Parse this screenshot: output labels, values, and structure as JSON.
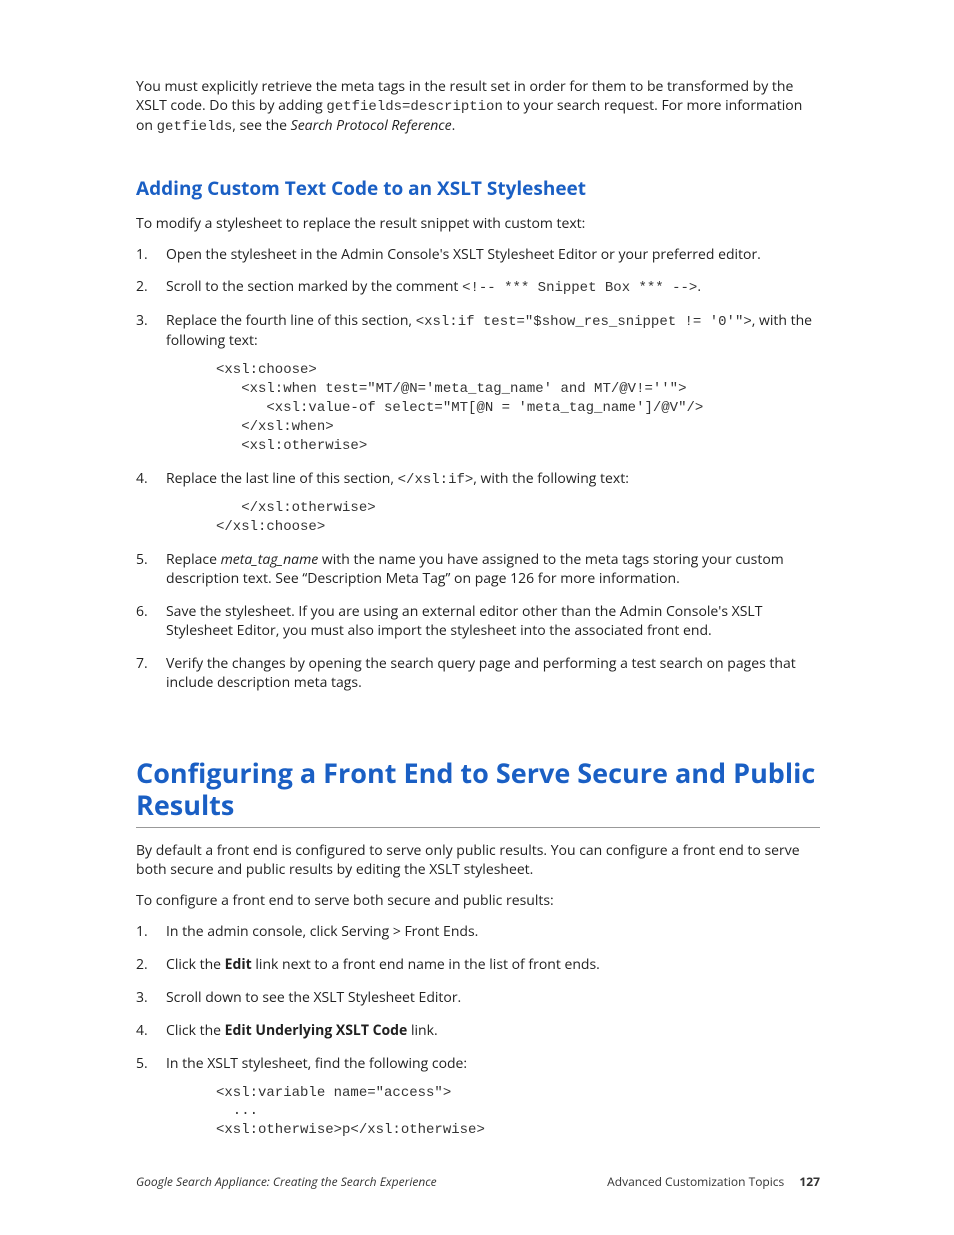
{
  "intro": {
    "p1a": "You must explicitly retrieve the meta tags in the result set in order for them to be transformed by the XSLT code. Do this by adding ",
    "code1": "getfields=description",
    "p1b": " to your search request. For more information on ",
    "code2": "getfields",
    "p1c": ", see the ",
    "ital": "Search Protocol Reference",
    "p1d": "."
  },
  "h2": "Adding Custom Text Code to an XSLT Stylesheet",
  "lead1": "To modify a stylesheet to replace the result snippet with custom text:",
  "steps1": {
    "s1": "Open the stylesheet in the Admin Console's XSLT Stylesheet Editor or your preferred editor.",
    "s2a": "Scroll to the section marked by the comment ",
    "s2code": "<!-- *** Snippet Box *** -->",
    "s2b": ".",
    "s3a": "Replace the fourth line of this section, ",
    "s3code": "<xsl:if test=\"$show_res_snippet != '0'\">",
    "s3b": ", with the following text:",
    "code3": "<xsl:choose>\n   <xsl:when test=\"MT/@N='meta_tag_name' and MT/@V!=''\">\n      <xsl:value-of select=\"MT[@N = 'meta_tag_name']/@V\"/>\n   </xsl:when>\n   <xsl:otherwise>",
    "s4a": "Replace the last line of this section, ",
    "s4code": "</xsl:if>",
    "s4b": ", with the following text:",
    "code4": "   </xsl:otherwise>\n</xsl:choose>",
    "s5a": "Replace ",
    "s5ital": "meta_tag_name",
    "s5b": " with the name you have assigned to the meta tags storing your custom description text. See “Description Meta Tag” on page 126 for more information.",
    "s6": "Save the stylesheet. If you are using an external editor other than the Admin Console's XSLT Stylesheet Editor, you must also import the stylesheet into the associated front end.",
    "s7": "Verify the changes by opening the search query page and performing a test search on pages that include description meta tags."
  },
  "h1": "Configuring a Front End to Serve Secure and Public Results",
  "lead2": "By default a front end is configured to serve only public results. You can configure a front end to serve both secure and public results by editing the XSLT stylesheet.",
  "lead3": "To configure a front end to serve both secure and public results:",
  "steps2": {
    "s1": "In the admin console, click Serving > Front Ends.",
    "s2a": "Click the ",
    "s2bold": "Edit",
    "s2b": " link next to a front end name in the list of front ends.",
    "s3": "Scroll down to see the XSLT Stylesheet Editor.",
    "s4a": "Click the ",
    "s4bold": "Edit Underlying XSLT Code",
    "s4b": " link.",
    "s5": "In the XSLT stylesheet, find the following code:",
    "code5": "<xsl:variable name=\"access\">\n  ...\n<xsl:otherwise>p</xsl:otherwise>"
  },
  "footer": {
    "left": "Google Search Appliance: Creating the Search Experience",
    "rightText": "Advanced Customization Topics",
    "page": "127"
  }
}
